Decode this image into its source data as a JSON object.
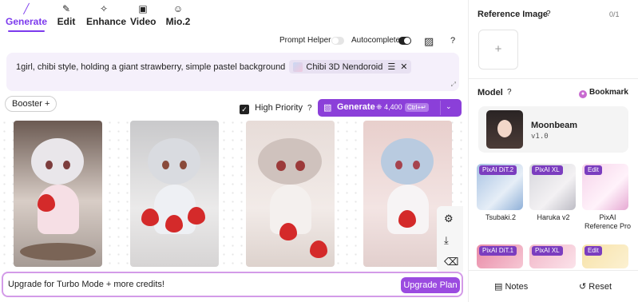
{
  "tabs": [
    {
      "label": "Generate",
      "icon": "wand-icon",
      "glyph": "╱"
    },
    {
      "label": "Edit",
      "icon": "pencil-icon",
      "glyph": "✎"
    },
    {
      "label": "Enhance",
      "icon": "sparkle-icon",
      "glyph": "✧"
    },
    {
      "label": "Video",
      "icon": "video-icon",
      "glyph": "▣"
    },
    {
      "label": "Mio.2",
      "icon": "mio-icon",
      "glyph": "☺"
    }
  ],
  "toolbar": {
    "prompt_helper_label": "Prompt Helper",
    "prompt_helper_on": false,
    "autocomplete_label": "Autocomplete",
    "autocomplete_on": true,
    "layout_glyph": "▨",
    "help_glyph": "?"
  },
  "prompt": {
    "text": "1girl, chibi style, holding a giant strawberry, simple pastel background",
    "chip_label": "Chibi 3D Nendoroid",
    "chip_settings_glyph": "☰",
    "chip_remove_glyph": "✕",
    "resize_glyph": "⤢"
  },
  "booster": {
    "label": "Booster",
    "glyph": "+"
  },
  "priority": {
    "label": "High Priority",
    "checked": true,
    "check_glyph": "✓",
    "help_glyph": "?"
  },
  "generate": {
    "label": "Generate",
    "icon_glyph": "▧",
    "cost": "4,400",
    "cost_glyph": "❈",
    "shortcut": "Ctrl+↵",
    "caret": "⌄"
  },
  "gallery_tools": [
    {
      "name": "edit-image-icon",
      "glyph": "⚙"
    },
    {
      "name": "download-icon",
      "glyph": "⤓"
    },
    {
      "name": "delete-icon",
      "glyph": "⌫"
    }
  ],
  "upgrade": {
    "text": "Upgrade for Turbo Mode + more credits!",
    "button": "Upgrade Plan"
  },
  "reference": {
    "title": "Reference Image",
    "count": "0/1",
    "help_glyph": "?",
    "add_glyph": "+"
  },
  "model": {
    "title": "Model",
    "help_glyph": "?",
    "bookmark": "Bookmark",
    "selected": {
      "name": "Moonbeam",
      "version": "v1.0"
    },
    "options": [
      {
        "badge": "PixAI DiT.2",
        "label": "Tsubaki.2"
      },
      {
        "badge": "PixAI XL",
        "label": "Haruka v2"
      },
      {
        "badge": "Edit",
        "label": "PixAI Reference Pro"
      },
      {
        "badge": "PixAI DiT.1",
        "label": ""
      },
      {
        "badge": "PixAI XL",
        "label": ""
      },
      {
        "badge": "Edit",
        "label": ""
      }
    ]
  },
  "bottom": {
    "notes": "Notes",
    "notes_glyph": "▤",
    "reset": "Reset",
    "reset_glyph": "↺"
  },
  "colors": {
    "accent": "#7c3aed",
    "generate_button": "#8b3fd9",
    "prompt_bg": "#f5f0fb"
  }
}
